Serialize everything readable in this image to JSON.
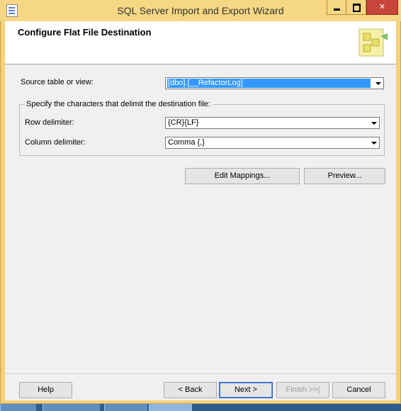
{
  "window": {
    "title": "SQL Server Import and Export Wizard"
  },
  "header": {
    "title": "Configure Flat File Destination"
  },
  "source": {
    "label": "Source table or view:",
    "value": "[dbo].[__RefactorLog]"
  },
  "group": {
    "legend": "Specify the characters that delimit the destination file:",
    "row_label": "Row delimiter:",
    "row_value": "{CR}{LF}",
    "column_label": "Column delimiter:",
    "column_value": "Comma {,}"
  },
  "actions": {
    "edit_mappings": "Edit Mappings...",
    "preview": "Preview..."
  },
  "footer": {
    "help": "Help",
    "back": "< Back",
    "next": "Next >",
    "finish": "Finish >>|",
    "cancel": "Cancel"
  },
  "icons": [
    "document-icon",
    "minimize-icon",
    "maximize-icon",
    "close-icon",
    "dropdown-arrow-icon",
    "wizard-graphic-icon"
  ]
}
